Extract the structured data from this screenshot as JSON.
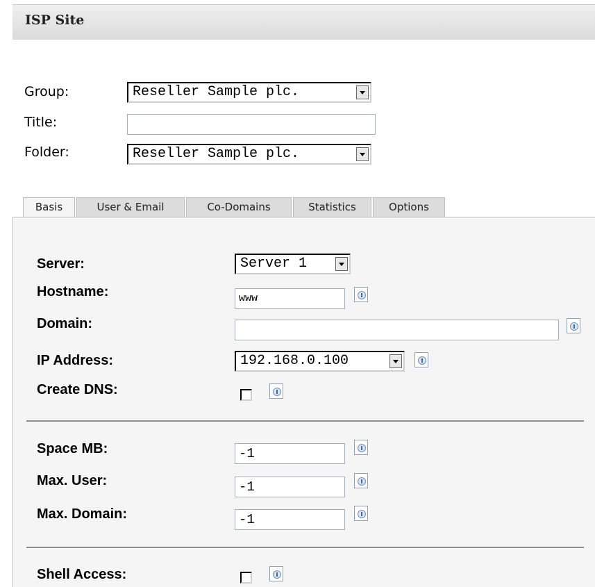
{
  "header": {
    "title": "ISP Site"
  },
  "form": {
    "group": {
      "label": "Group:",
      "value": "Reseller Sample plc."
    },
    "title": {
      "label": "Title:",
      "value": ""
    },
    "folder": {
      "label": "Folder:",
      "value": "Reseller Sample plc."
    }
  },
  "tabs": [
    {
      "label": "Basis",
      "active": true
    },
    {
      "label": "User & Email",
      "active": false
    },
    {
      "label": "Co-Domains",
      "active": false
    },
    {
      "label": "Statistics",
      "active": false
    },
    {
      "label": "Options",
      "active": false
    }
  ],
  "basis": {
    "server": {
      "label": "Server:",
      "value": "Server 1"
    },
    "hostname": {
      "label": "Hostname:",
      "value": "www"
    },
    "domain": {
      "label": "Domain:",
      "value": ""
    },
    "ip_address": {
      "label": "IP Address:",
      "value": "192.168.0.100"
    },
    "create_dns": {
      "label": "Create DNS:",
      "checked": false
    },
    "space_mb": {
      "label": "Space MB:",
      "value": "-1"
    },
    "max_user": {
      "label": "Max. User:",
      "value": "-1"
    },
    "max_domain": {
      "label": "Max. Domain:",
      "value": "-1"
    },
    "shell_access": {
      "label": "Shell Access:",
      "checked": false
    }
  },
  "icons": {
    "dropdown": "chevron-down-icon",
    "help": "info-icon"
  },
  "colors": {
    "panel_bg": "#f5f5f5",
    "tab_bg": "#dcdcdc",
    "header_bg": "#e6e6e6"
  }
}
